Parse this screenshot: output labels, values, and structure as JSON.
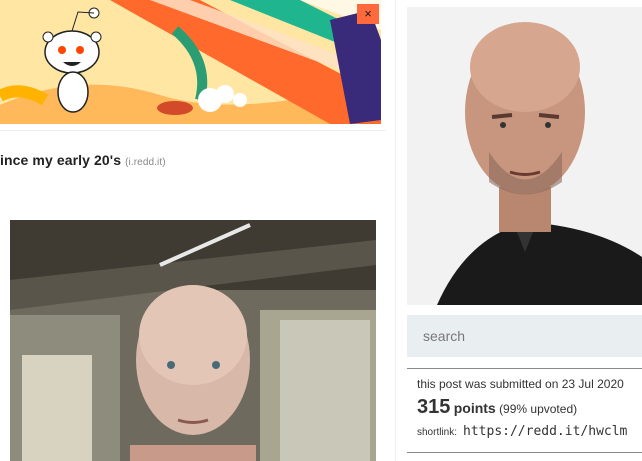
{
  "banner": {
    "close_label": "×"
  },
  "post": {
    "title": "ince my early 20's",
    "domain": "(i.redd.it)"
  },
  "sidebar": {
    "search_placeholder": "search",
    "submitted": "this post was submitted on 23 Jul 2020",
    "points": "315",
    "points_label": "points",
    "upvoted": "(99% upvoted)",
    "shortlink_label": "shortlink:",
    "shortlink_url": "https://redd.it/hwclm"
  },
  "colors": {
    "accent": "#ff4500",
    "search_bg": "#e9eef1",
    "banner_bg": "#ffe9a8"
  }
}
